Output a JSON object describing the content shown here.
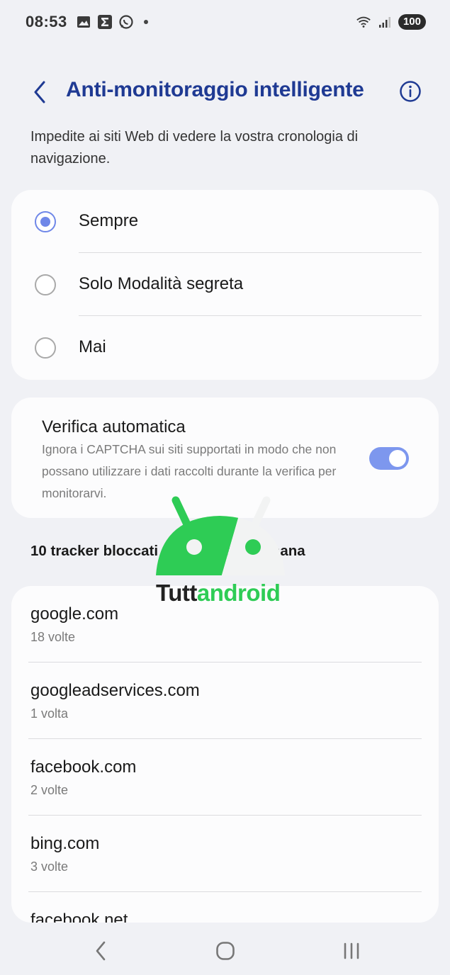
{
  "status_bar": {
    "time": "08:53",
    "battery": "100",
    "icons_left": [
      "image-icon",
      "sigma-app-icon",
      "whatsapp-icon",
      "notification-dot-icon"
    ],
    "icons_right": [
      "wifi-icon",
      "signal-icon",
      "battery-icon"
    ]
  },
  "header": {
    "title": "Anti-monitoraggio intelligente",
    "back_icon": "chevron-left-icon",
    "info_icon": "info-circle-icon"
  },
  "description": "Impedite ai siti Web di vedere la vostra cronologia di navigazione.",
  "options": [
    {
      "label": "Sempre",
      "selected": true
    },
    {
      "label": "Solo Modalità segreta",
      "selected": false
    },
    {
      "label": "Mai",
      "selected": false
    }
  ],
  "auto_verify": {
    "title": "Verifica automatica",
    "description": "Ignora i CAPTCHA sui siti supportati in modo che non possano utilizzare i dati raccolti durante la verifica per monitorarvi.",
    "enabled": true
  },
  "trackers": {
    "header": "10 tracker bloccati nell'ultima settimana",
    "items": [
      {
        "domain": "google.com",
        "count": "18 volte"
      },
      {
        "domain": "googleadservices.com",
        "count": "1 volta"
      },
      {
        "domain": "facebook.com",
        "count": "2 volte"
      },
      {
        "domain": "bing.com",
        "count": "3 volte"
      },
      {
        "domain": "facebook.net",
        "count": ""
      }
    ]
  },
  "watermark": {
    "text_a": "Tutt",
    "text_b": "android"
  },
  "nav": {
    "icons": [
      "back-nav-icon",
      "home-nav-icon",
      "recents-nav-icon"
    ]
  },
  "colors": {
    "accent": "#1f3a93",
    "radio": "#6f87e8",
    "toggle": "#7d97ee",
    "background": "#f0f1f5",
    "watermark_green": "#2ecc55"
  }
}
